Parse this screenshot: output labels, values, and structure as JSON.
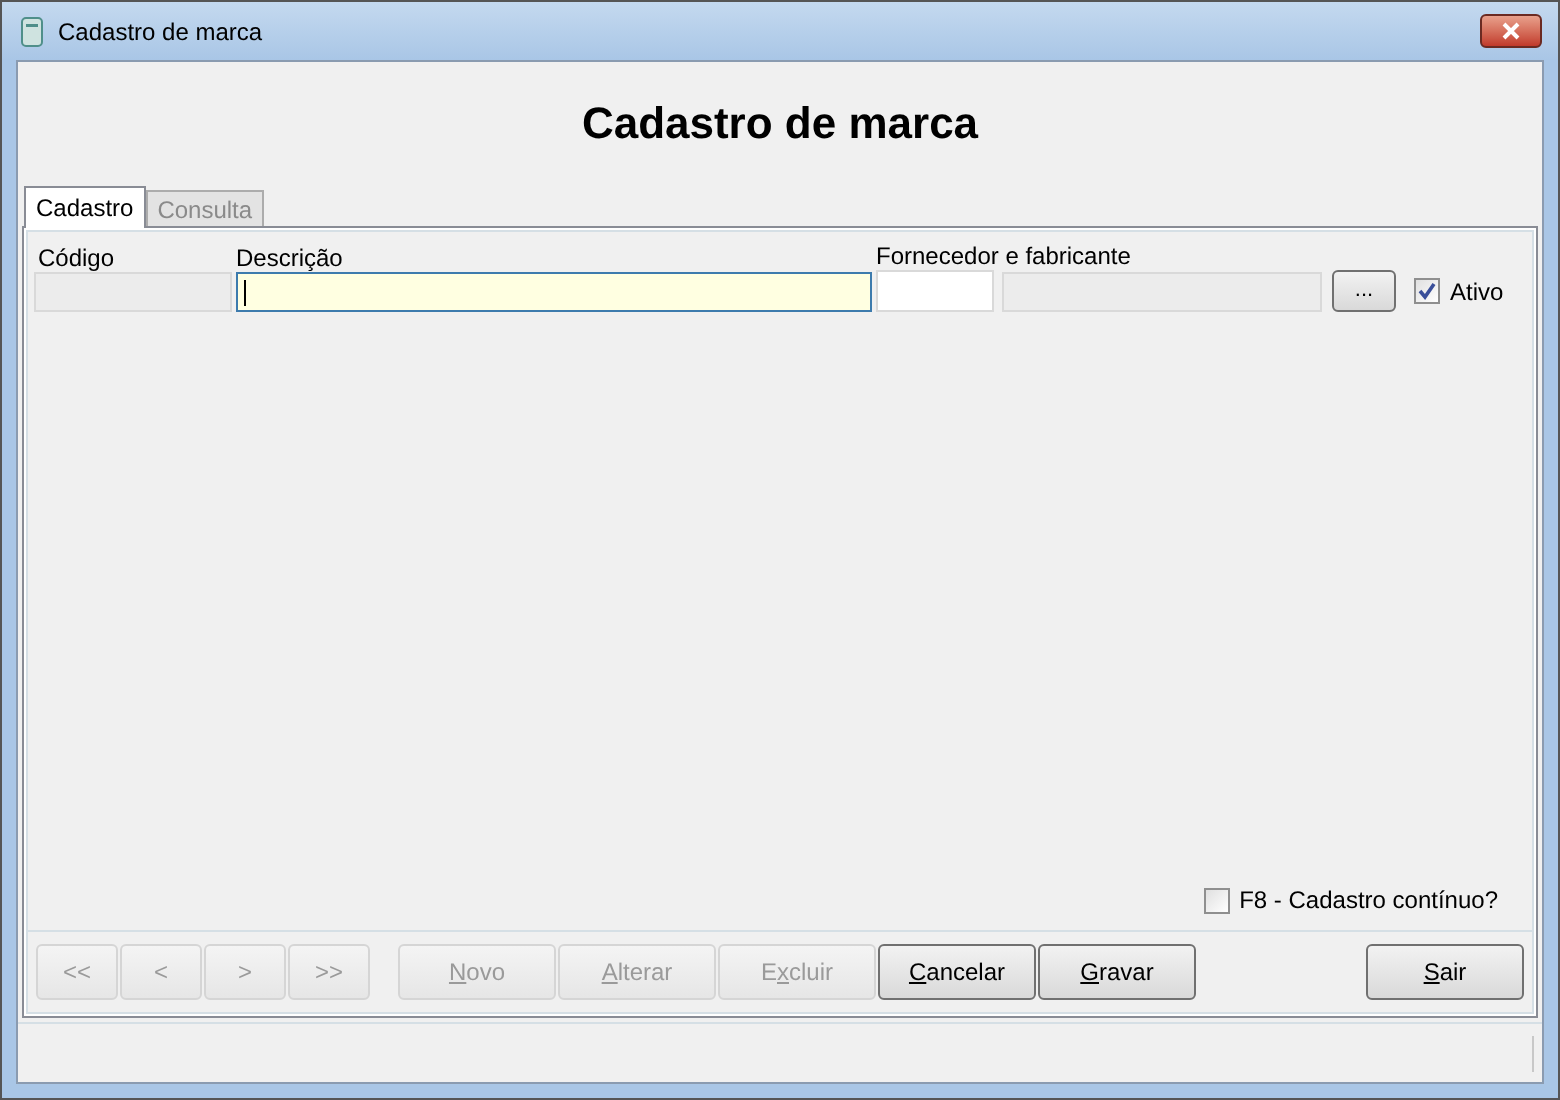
{
  "window": {
    "title": "Cadastro de marca"
  },
  "heading": "Cadastro de marca",
  "tabs": [
    {
      "label": "Cadastro",
      "selected": true
    },
    {
      "label": "Consulta",
      "selected": false
    }
  ],
  "fields": {
    "codigo": {
      "label": "Código",
      "disabled": true
    },
    "descricao": {
      "label": "Descrição",
      "focused": true
    },
    "fornecedor": {
      "label": "Fornecedor e fabricante"
    },
    "browse_button": "...",
    "ativo": {
      "label": "Ativo",
      "checked": true
    }
  },
  "continuous": {
    "label": "F8 - Cadastro contínuo?",
    "checked": false
  },
  "nav_buttons": [
    {
      "label": "<<",
      "disabled": true
    },
    {
      "label": "<",
      "disabled": true
    },
    {
      "label": ">",
      "disabled": true
    },
    {
      "label": ">>",
      "disabled": true
    }
  ],
  "action_buttons": [
    {
      "label": {
        "key": "N",
        "after": "ovo"
      },
      "disabled": true
    },
    {
      "label": {
        "key": "A",
        "after": "lterar"
      },
      "disabled": true
    },
    {
      "label": {
        "before": "E",
        "key": "x",
        "after": "cluir"
      },
      "disabled": true
    },
    {
      "label": {
        "key": "C",
        "after": "ancelar"
      },
      "disabled": false
    },
    {
      "label": {
        "key": "G",
        "after": "ravar"
      },
      "disabled": false
    }
  ],
  "exit_button": {
    "label": {
      "key": "S",
      "after": "air"
    },
    "disabled": false
  }
}
